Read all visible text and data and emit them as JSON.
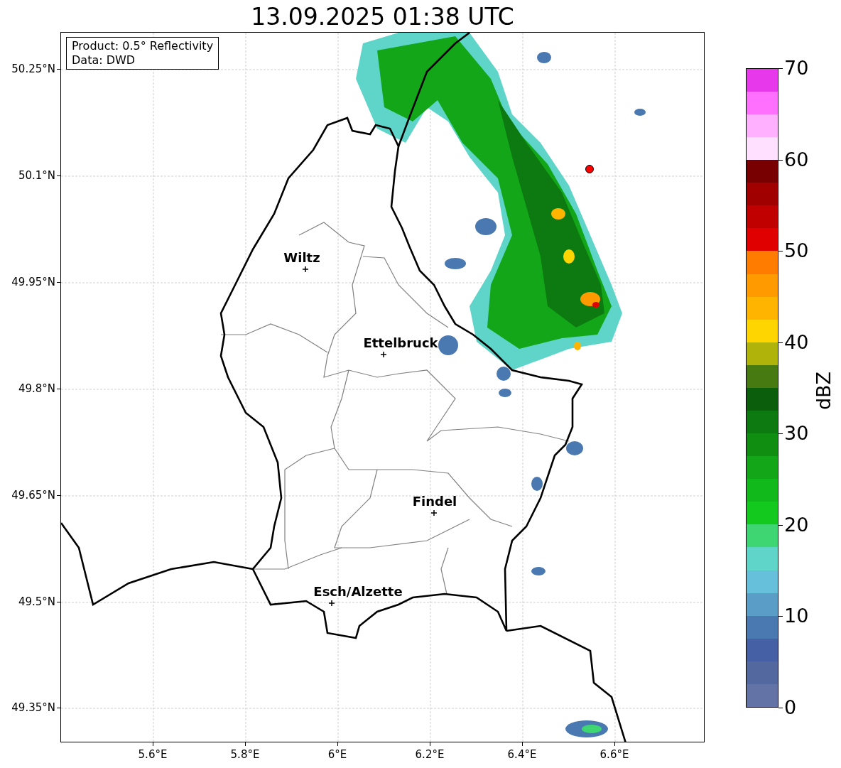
{
  "title": "13.09.2025 01:38 UTC",
  "info_box": [
    "Product: 0.5° Reflectivity",
    "Data: DWD"
  ],
  "map": {
    "lat_labels": [
      "50.25°N",
      "50.1°N",
      "49.95°N",
      "49.8°N",
      "49.65°N",
      "49.5°N",
      "49.35°N"
    ],
    "lon_labels": [
      "5.6°E",
      "5.8°E",
      "6°E",
      "6.2°E",
      "6.4°E",
      "6.6°E"
    ],
    "cities": [
      {
        "name": "Wiltz"
      },
      {
        "name": "Ettelbruck"
      },
      {
        "name": "Findel"
      },
      {
        "name": "Esch/Alzette"
      }
    ]
  },
  "colorbar": {
    "label": "dBZ",
    "ticks": [
      "70",
      "60",
      "50",
      "40",
      "30",
      "20",
      "10",
      "0"
    ],
    "bins": [
      {
        "color": "#6473a6"
      },
      {
        "color": "#53689e"
      },
      {
        "color": "#4660a6"
      },
      {
        "color": "#4a78b0"
      },
      {
        "color": "#5a9dc6"
      },
      {
        "color": "#66c0dc"
      },
      {
        "color": "#5ed5c8"
      },
      {
        "color": "#3ed673"
      },
      {
        "color": "#14c91e"
      },
      {
        "color": "#12b91a"
      },
      {
        "color": "#12a618"
      },
      {
        "color": "#0f8e12"
      },
      {
        "color": "#0c7a10"
      },
      {
        "color": "#0a5e0c"
      },
      {
        "color": "#477a10"
      },
      {
        "color": "#b0b40a"
      },
      {
        "color": "#ffd500"
      },
      {
        "color": "#ffb400"
      },
      {
        "color": "#ff9a00"
      },
      {
        "color": "#ff7c00"
      },
      {
        "color": "#e00000"
      },
      {
        "color": "#c00000"
      },
      {
        "color": "#a00000"
      },
      {
        "color": "#780000"
      },
      {
        "color": "#ffe0ff"
      },
      {
        "color": "#ffb0ff"
      },
      {
        "color": "#ff70ff"
      },
      {
        "color": "#e838ec"
      }
    ]
  }
}
